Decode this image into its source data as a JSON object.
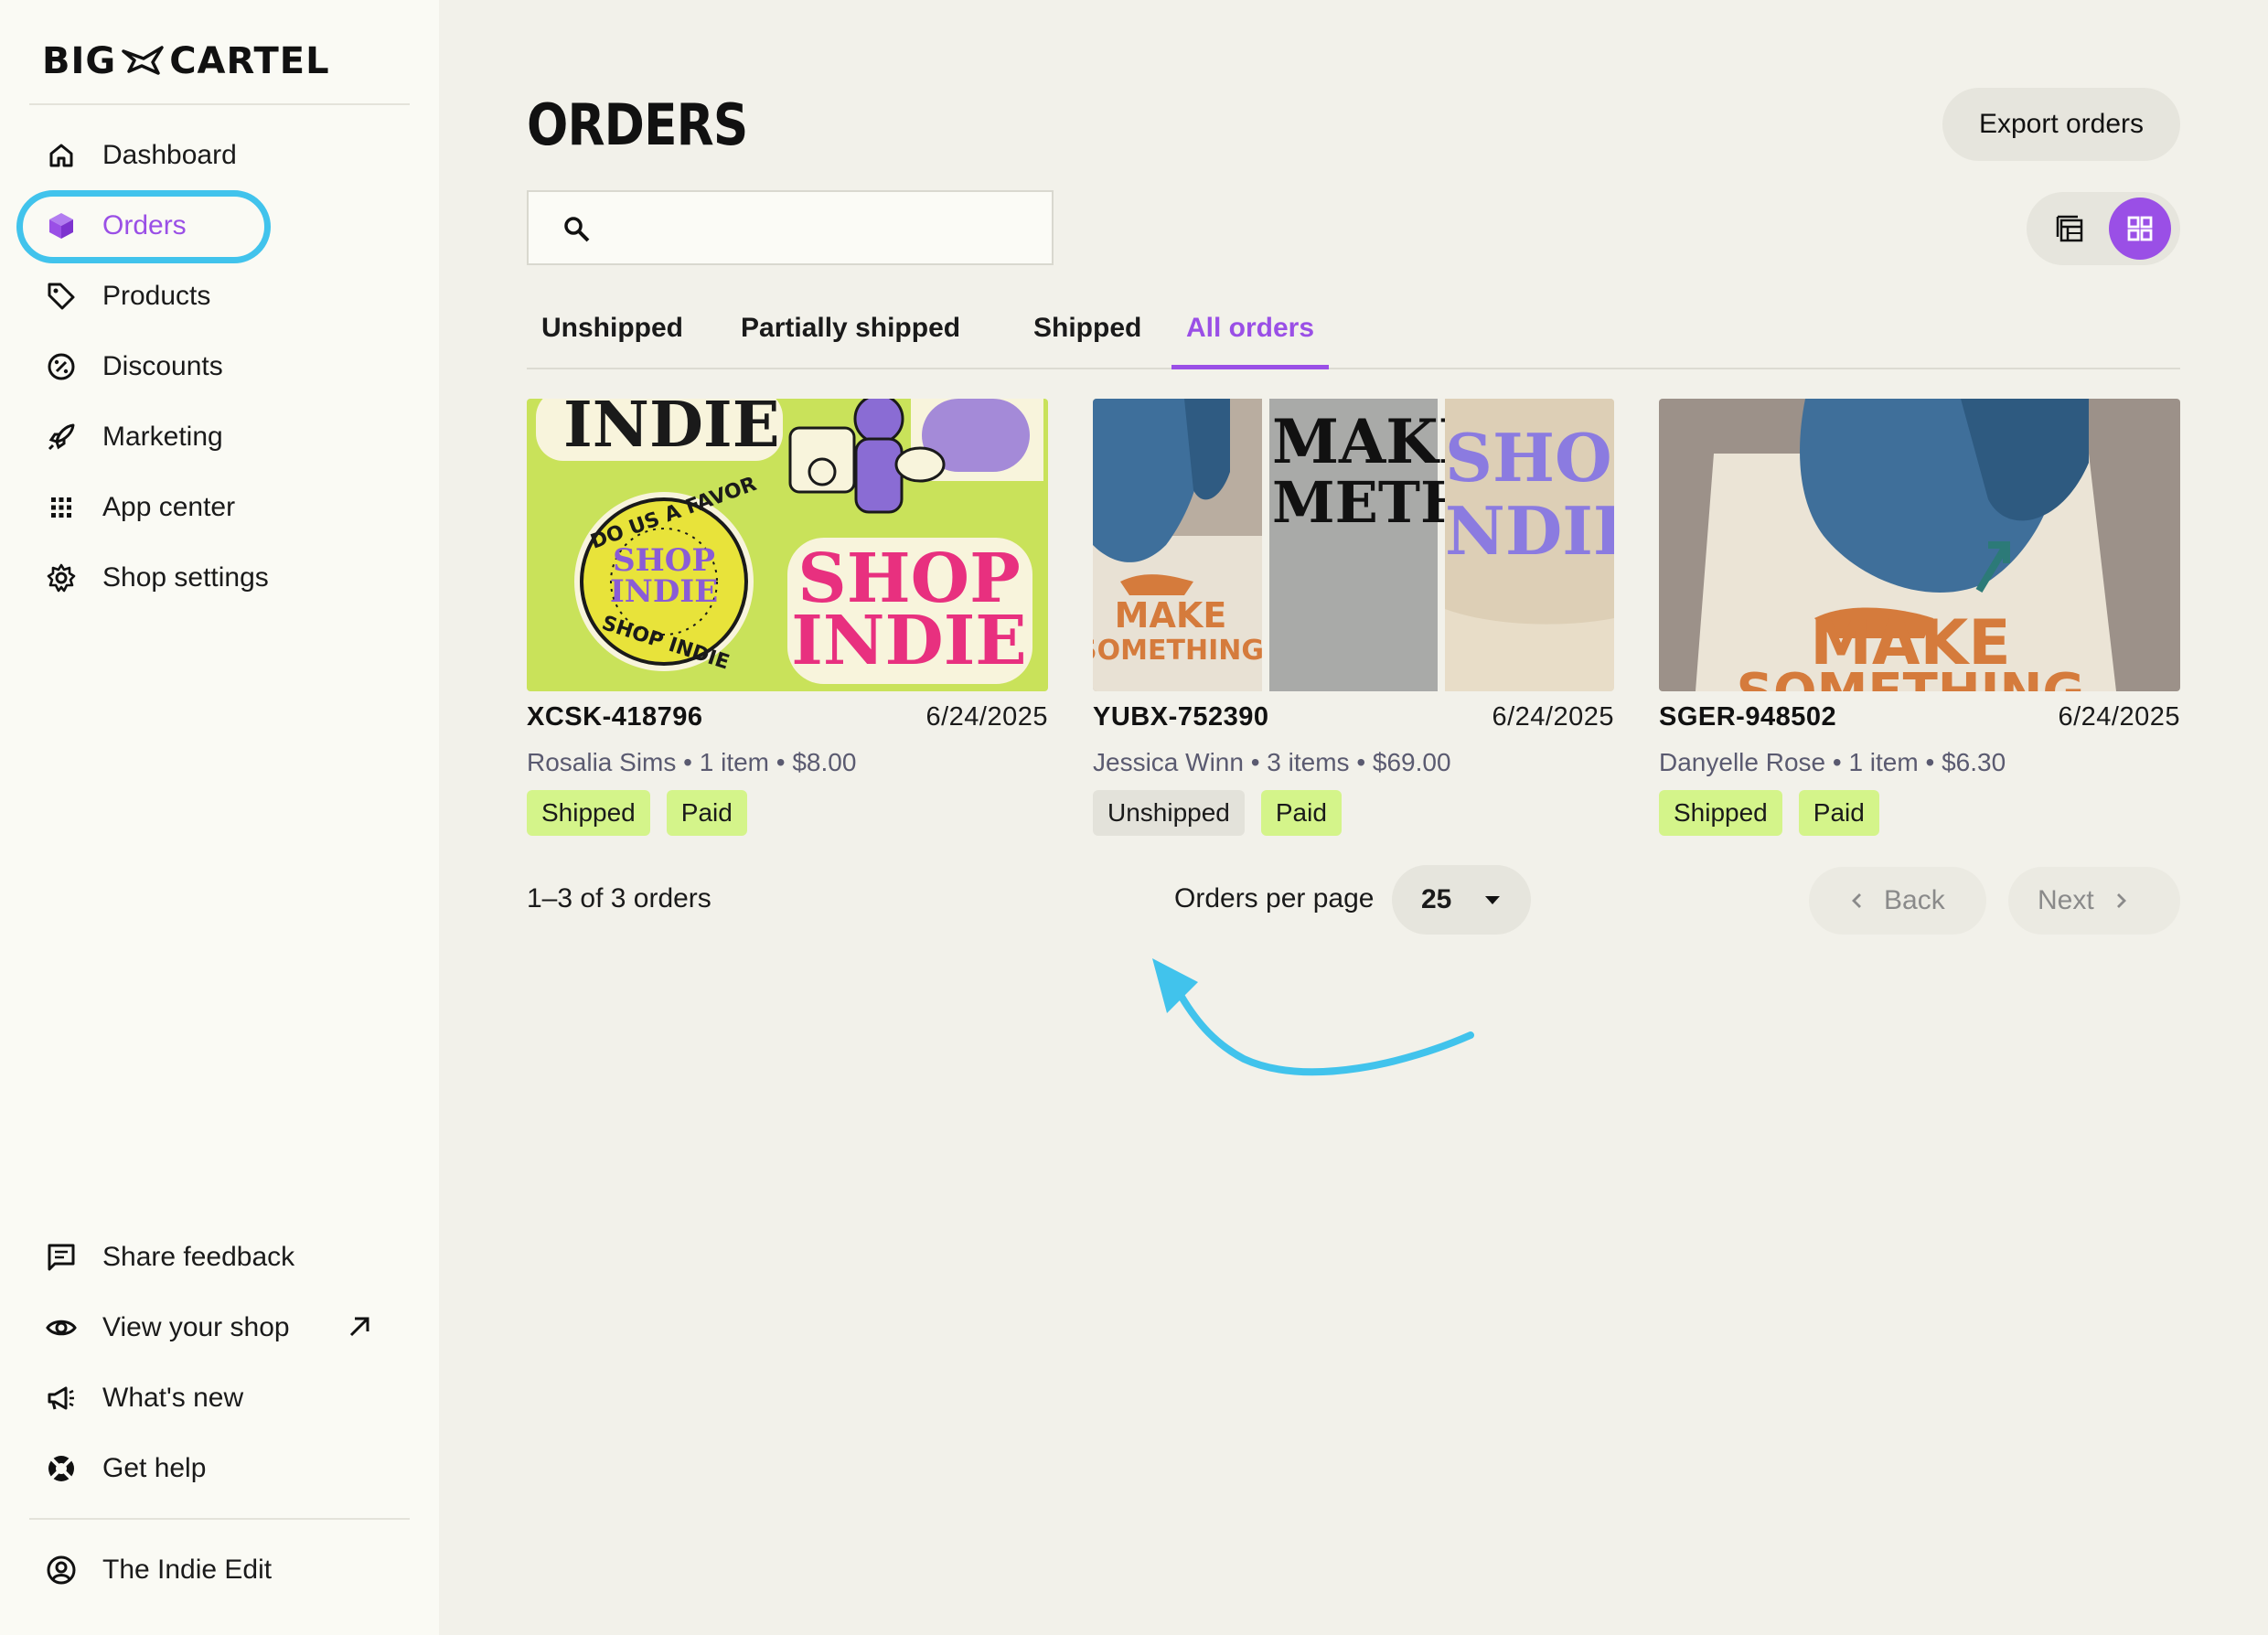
{
  "brand": {
    "logo_left": "BIG",
    "logo_right": "CARTEL"
  },
  "sidebar": {
    "items": [
      {
        "label": "Dashboard",
        "icon": "home-icon"
      },
      {
        "label": "Orders",
        "icon": "box-icon",
        "active": true
      },
      {
        "label": "Products",
        "icon": "tag-icon"
      },
      {
        "label": "Discounts",
        "icon": "discount-icon"
      },
      {
        "label": "Marketing",
        "icon": "rocket-icon"
      },
      {
        "label": "App center",
        "icon": "grid-dots-icon"
      },
      {
        "label": "Shop settings",
        "icon": "gear-icon"
      }
    ],
    "bottom_items": [
      {
        "label": "Share feedback",
        "icon": "chat-icon"
      },
      {
        "label": "View your shop",
        "icon": "eye-icon"
      },
      {
        "label": "What's new",
        "icon": "megaphone-icon"
      },
      {
        "label": "Get help",
        "icon": "lifebuoy-icon"
      }
    ],
    "account": {
      "label": "The Indie Edit",
      "icon": "user-circle-icon"
    }
  },
  "page": {
    "title": "ORDERS",
    "export_label": "Export orders"
  },
  "search": {
    "value": "",
    "placeholder": ""
  },
  "tabs": [
    {
      "label": "Unshipped"
    },
    {
      "label": "Partially shipped"
    },
    {
      "label": "Shipped"
    },
    {
      "label": "All orders",
      "active": true
    }
  ],
  "orders": [
    {
      "id": "XCSK-418796",
      "date": "6/24/2025",
      "meta": "Rosalia Sims • 1 item • $8.00",
      "badges": [
        "Shipped",
        "Paid"
      ]
    },
    {
      "id": "YUBX-752390",
      "date": "6/24/2025",
      "meta": "Jessica Winn • 3 items • $69.00",
      "badges": [
        "Unshipped",
        "Paid"
      ]
    },
    {
      "id": "SGER-948502",
      "date": "6/24/2025",
      "meta": "Danyelle Rose • 1 item • $6.30",
      "badges": [
        "Shipped",
        "Paid"
      ]
    }
  ],
  "product_art": {
    "sticker_top": "INDIE",
    "sticker_ring": "DO US A FAVOR",
    "sticker_center_1": "SHOP",
    "sticker_center_2": "INDIE",
    "sticker_ring_bottom": "SHOP INDIE",
    "sticker_big_1": "SHOP",
    "sticker_big_2": "INDIE",
    "tote_1": "MAKE",
    "tote_2": "SOMETHING",
    "shirt_1": "MAKE",
    "shirt_2": "METHI",
    "cap_1": "SHOP",
    "cap_2": "NDII"
  },
  "pagination": {
    "count": "1–3 of 3 orders",
    "per_page_label": "Orders per page",
    "per_page_value": "25",
    "back_label": "Back",
    "next_label": "Next"
  },
  "colors": {
    "accent": "#9a4fe6",
    "highlight": "#41c3ec",
    "paid_badge": "#d4f48a"
  }
}
